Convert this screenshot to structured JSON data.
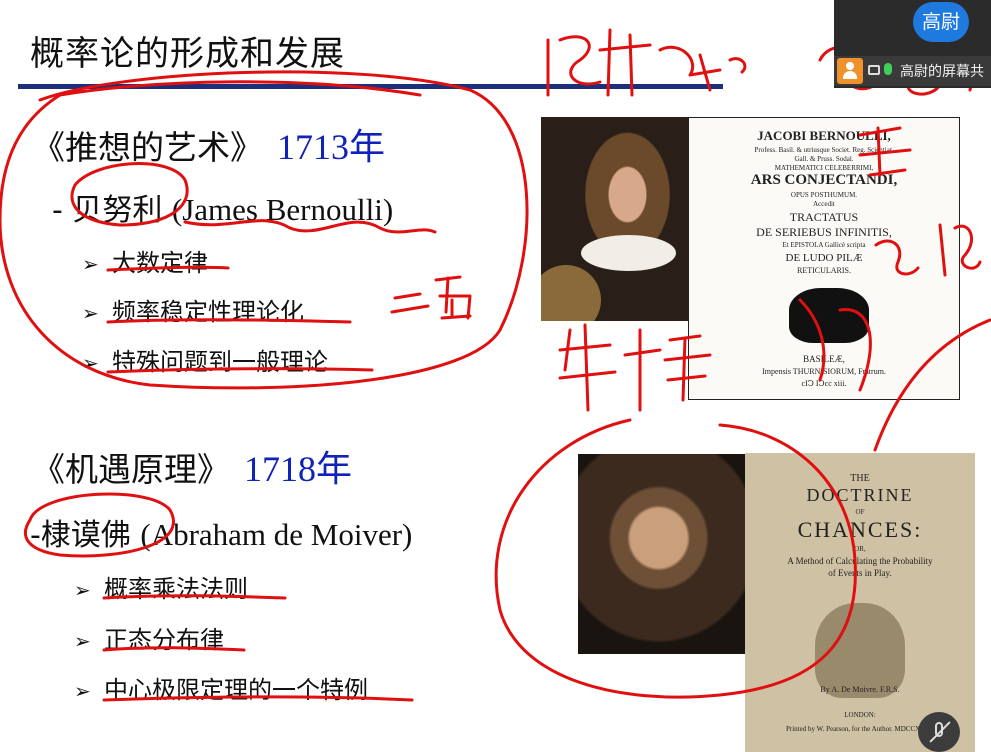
{
  "slide": {
    "title": "概率论的形成和发展",
    "section1": {
      "book": "《推想的艺术》",
      "year": "1713年",
      "author_prefix": "- 贝努利 ",
      "author_latin": "(James Bernoulli)",
      "bullets": [
        "大数定律",
        "频率稳定性理论化",
        "特殊问题到一般理论"
      ]
    },
    "section2": {
      "book": "《机遇原理》",
      "year": "1718年",
      "author_prefix": "-棣谟佛 ",
      "author_latin": "(Abraham de Moiver)",
      "bullets": [
        "概率乘法法则",
        "正态分布律",
        "中心极限定理的一个特例"
      ]
    },
    "bullet_glyph": "➢",
    "book1_cover": {
      "lines": [
        "JACOBI BERNOULLI,",
        "Profess. Basil. & utriusque Societ. Reg. Scientiar.",
        "Gall. & Pruss. Sodal.",
        "MATHEMATICI CELEBERRIMI,",
        "ARS CONJECTANDI,",
        "OPUS POSTHUMUM.",
        "Accedit",
        "TRACTATUS",
        "DE SERIEBUS INFINITIS,",
        "Et EPISTOLA Gallicè scripta",
        "DE LUDO PILÆ",
        "RETICULARIS.",
        "BASILEÆ,",
        "Impensis THURNISIORUM, Fratrum.",
        "cIↃ IↃcc xiii."
      ]
    },
    "book2_cover": {
      "lines": [
        "THE",
        "DOCTRINE",
        "OF",
        "CHANCES:",
        "OR,",
        "A Method of Calculating the Probability",
        "of Events in Play.",
        "By A. De Moivre. F.R.S.",
        "LONDON:",
        "Printed by W. Pearson, for the Author. MDCCXVIII."
      ]
    }
  },
  "call_overlay": {
    "participant_name": "高尉",
    "share_label": "高尉的屏幕共",
    "accent": "#1f7ae0",
    "icons": [
      "user-icon",
      "screen-share-icon",
      "microphone-icon",
      "mute-microphone-icon"
    ]
  },
  "ink_color": "#e01010"
}
